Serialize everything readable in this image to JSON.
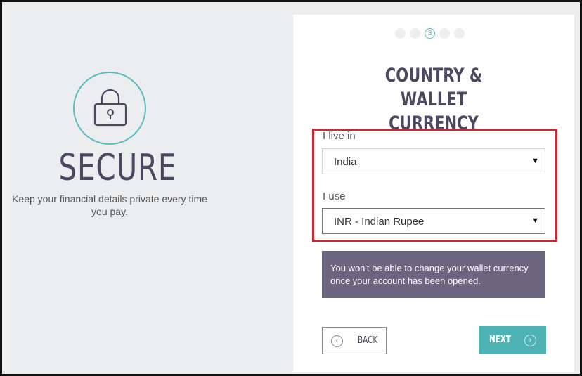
{
  "promo": {
    "title": "SECURE",
    "description": "Keep your financial details private every time you pay."
  },
  "progress": {
    "current_step": "3",
    "total_steps": 5
  },
  "card": {
    "title": "COUNTRY & WALLET CURRENCY"
  },
  "form": {
    "country_label": "I live in",
    "country_value": "India",
    "currency_label": "I use",
    "currency_value": "INR - Indian Rupee"
  },
  "notice": {
    "text": "You won't be able to change your wallet currency once your account has been opened."
  },
  "buttons": {
    "back_label": "BACK",
    "next_label": "NEXT"
  },
  "colors": {
    "accent": "#4eb3b5",
    "brand_dark": "#4d4861",
    "notice_bg": "#6c6580",
    "highlight": "#d3242f"
  },
  "icons": {
    "lock": "lock-icon",
    "back": "chevron-left-circle-icon",
    "next": "chevron-right-circle-icon",
    "select_caret": "caret-down-icon"
  }
}
